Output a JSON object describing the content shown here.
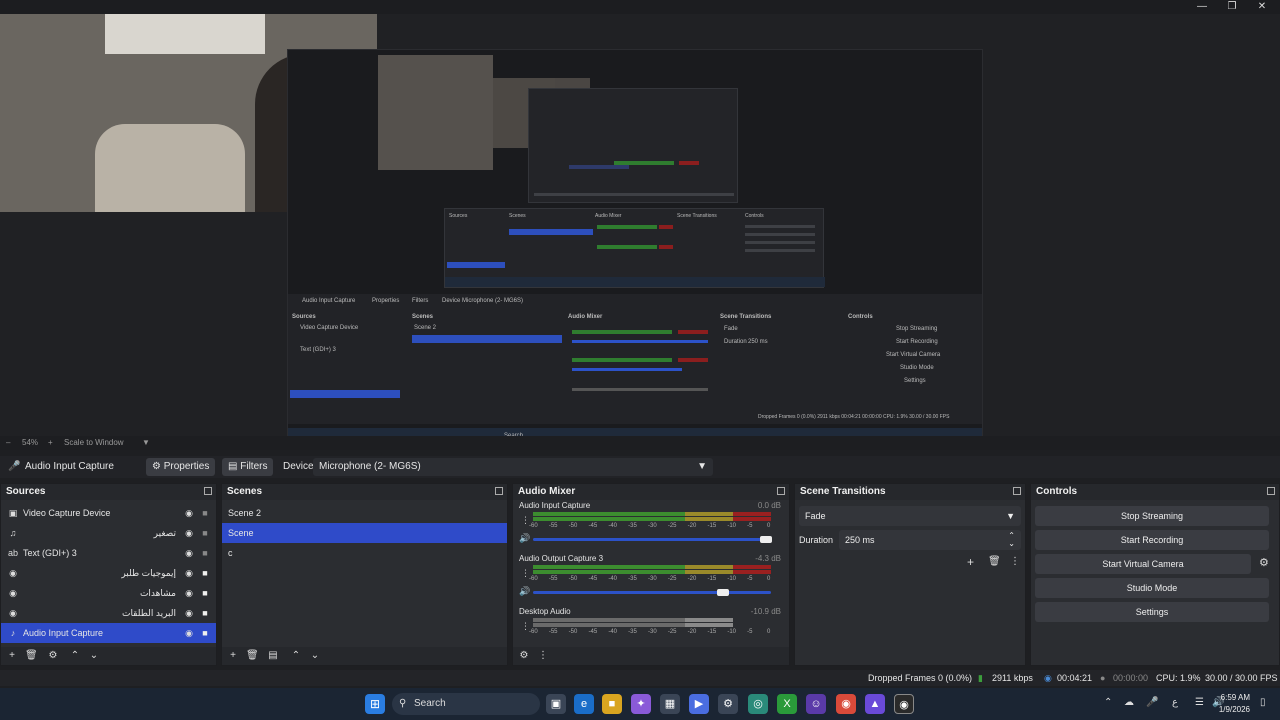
{
  "window": {
    "minimize_icon": "minimize-icon",
    "maximize_icon": "maximize-icon",
    "close_icon": "close-icon"
  },
  "preview": {
    "nested_text": {
      "sources": "Sources",
      "scenes": "Scenes",
      "audio_mixer": "Audio Mixer",
      "scene_transitions": "Scene Transitions",
      "controls": "Controls",
      "audio_input_capture": "Audio Input Capture",
      "properties": "Properties",
      "filters": "Filters",
      "device": "Device",
      "device_value": "Microphone (2- MG6S)",
      "video_capture": "Video Capture Device",
      "text_gdi": "Text (GDI+) 3",
      "scene2": "Scene 2",
      "scene": "Scene",
      "fade": "Fade",
      "duration": "Duration",
      "duration_value": "250 ms",
      "stop_streaming": "Stop Streaming",
      "start_recording": "Start Recording",
      "start_virtual_camera": "Start Virtual Camera",
      "studio_mode": "Studio Mode",
      "settings": "Settings",
      "audio_output_capture": "Audio Output Capture 3",
      "desktop_audio": "Desktop Audio",
      "search": "Search",
      "status": "Dropped Frames 0 (0.0%)  2911 kbps  00:04:21  00:00:00  CPU: 1.9%  30.00 / 30.00 FPS"
    }
  },
  "zoombar": {
    "zoom": "54%",
    "scale_mode": "Scale to Window"
  },
  "context": {
    "source_name": "Audio Input Capture",
    "properties_label": "Properties",
    "filters_label": "Filters",
    "device_label": "Device",
    "device_value": "Microphone (2- MG6S)"
  },
  "sources": {
    "title": "Sources",
    "items": [
      {
        "label": "Video Capture Device",
        "icon": "camera-icon",
        "rtl": false,
        "selected": false,
        "locked": false
      },
      {
        "label": "تصغير",
        "icon": "audio-icon",
        "rtl": true,
        "selected": false,
        "locked": false
      },
      {
        "label": "Text (GDI+) 3",
        "icon": "text-icon",
        "rtl": false,
        "selected": false,
        "locked": false
      },
      {
        "label": "إيموجيات طلبر",
        "icon": "browser-icon",
        "rtl": true,
        "selected": false,
        "locked": true
      },
      {
        "label": "مشاهدات",
        "icon": "browser-icon",
        "rtl": true,
        "selected": false,
        "locked": true
      },
      {
        "label": "البريد الطلقات",
        "icon": "browser-icon",
        "rtl": true,
        "selected": false,
        "locked": true
      },
      {
        "label": "Audio Input Capture",
        "icon": "microphone-icon",
        "rtl": false,
        "selected": true,
        "locked": true
      }
    ]
  },
  "scenes": {
    "title": "Scenes",
    "items": [
      {
        "label": "Scene 2",
        "selected": false
      },
      {
        "label": "Scene",
        "selected": true
      },
      {
        "label": "c",
        "selected": false
      }
    ]
  },
  "mixer": {
    "title": "Audio Mixer",
    "ticks": [
      "-60",
      "-55",
      "-50",
      "-45",
      "-40",
      "-35",
      "-30",
      "-25",
      "-20",
      "-15",
      "-10",
      "-5",
      "0"
    ],
    "channels": [
      {
        "name": "Audio Input Capture",
        "db": "0.0 dB",
        "volume": 0.98,
        "active": true
      },
      {
        "name": "Audio Output Capture 3",
        "db": "-4.3 dB",
        "volume": 0.8,
        "active": true
      },
      {
        "name": "Desktop Audio",
        "db": "-10.9 dB",
        "volume": 0,
        "active": false
      }
    ]
  },
  "transitions": {
    "title": "Scene Transitions",
    "selected": "Fade",
    "duration_label": "Duration",
    "duration_value": "250 ms"
  },
  "controls": {
    "title": "Controls",
    "stop_streaming": "Stop Streaming",
    "start_recording": "Start Recording",
    "start_virtual_camera": "Start Virtual Camera",
    "studio_mode": "Studio Mode",
    "settings": "Settings"
  },
  "status": {
    "dropped_frames": "Dropped Frames 0 (0.0%)",
    "bitrate": "2911 kbps",
    "stream_time": "00:04:21",
    "record_time": "00:00:00",
    "cpu": "CPU: 1.9%",
    "fps": "30.00 / 30.00 FPS"
  },
  "taskbar": {
    "search_placeholder": "Search",
    "time": "6:59 AM",
    "date": "1/9/2026",
    "colors": {
      "accent": "#2f4bc9",
      "meter_green": "#3c8d2f",
      "meter_yellow": "#9a8a2a",
      "meter_red": "#9a2020"
    }
  }
}
